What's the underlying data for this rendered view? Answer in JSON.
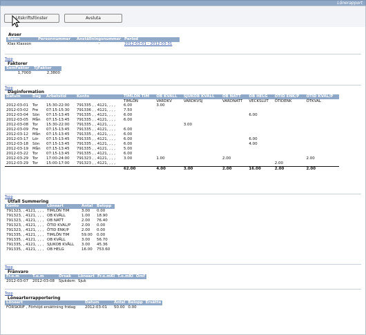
{
  "window": {
    "title": "Lönerapport"
  },
  "toolbar": {
    "print_label": "Utskriftsfönster",
    "close_label": "Avsluta"
  },
  "links": {
    "top": "Topp"
  },
  "avser": {
    "title": "Avser",
    "headers": [
      "Namn",
      "Personnummer",
      "Anställningsnummer",
      "Period"
    ],
    "row": [
      "Klas Klasson",
      "",
      "-",
      "2012-03-01 - 2012-03-31"
    ]
  },
  "faktorer": {
    "title": "Faktorer",
    "headers": [
      "SemFaktor",
      "TjFaktor"
    ],
    "row": [
      "1,7000",
      "2,3800"
    ]
  },
  "dag": {
    "title": "Daginformation",
    "headers": [
      "Datum",
      "Dag",
      "Arbetstid",
      "Konto",
      "TIMLÖN TIM",
      "OB KVÄLL",
      "SJUKOB KVÄLL",
      "OB NATT",
      "OB HELG",
      "ÖTID ENK/P",
      "ÖTID KVAL/P"
    ],
    "subheaders": [
      "",
      "",
      "",
      "",
      "TIMLÖN",
      "VARDKV",
      "VARDKVSJ",
      "VARDNATT",
      "VECKSLUT",
      "ÖTIDENK",
      "ÖTKVAL"
    ],
    "rows": [
      [
        "2012-03-01",
        "Tor",
        "15:30-22:00",
        "791335 , , 4121, , , ,",
        "6.00",
        "3.00",
        "",
        "",
        "",
        "",
        ""
      ],
      [
        "2012-03-02",
        "Fre",
        "07:15-15:30",
        "791336 , , 4121, , , ,",
        "7.50",
        "",
        "",
        "",
        "",
        "",
        ""
      ],
      [
        "2012-03-04",
        "Sön",
        "07:15-13:45",
        "791335 , , 4121, , , ,",
        "6.00",
        "",
        "",
        "",
        "6.00",
        "",
        ""
      ],
      [
        "2012-03-05",
        "Mån",
        "07:15-13:45",
        "791335 , , 4121, , , ,",
        "6.00",
        "",
        "",
        "",
        "",
        "",
        ""
      ],
      [
        "2012-03-08",
        "Tor",
        "15:30-22:00",
        "791335 , , 4121, , , ,",
        "",
        "",
        "3.00",
        "",
        "",
        "",
        ""
      ],
      [
        "2012-03-09",
        "Fre",
        "07:15-13:45",
        "791335 , , 4121, , , ,",
        "6.00",
        "",
        "",
        "",
        "",
        "",
        ""
      ],
      [
        "2012-03-12",
        "Mån",
        "07:15-13:45",
        "791335 , , 4121, , , ,",
        "6.00",
        "",
        "",
        "",
        "",
        "",
        ""
      ],
      [
        "2012-03-17",
        "Lör",
        "07:15-13:45",
        "791335 , , 4121, , , ,",
        "6.00",
        "",
        "",
        "",
        "6.00",
        "",
        ""
      ],
      [
        "2012-03-18",
        "Sön",
        "07:15-13:45",
        "791335 , , 4121, , , ,",
        "6.00",
        "",
        "",
        "",
        "4.00",
        "",
        ""
      ],
      [
        "2012-03-19",
        "Mån",
        "07:15-13:45",
        "791335 , , 4121, , , ,",
        "5.00",
        "",
        "",
        "",
        "",
        "",
        ""
      ],
      [
        "2012-03-22",
        "Tor",
        "07:15-13:45",
        "791335 , , 4121, , , ,",
        "6.00",
        "",
        "",
        "",
        "",
        "",
        ""
      ],
      [
        "2012-03-29",
        "Tor",
        "17:00-24:00",
        "791323 , , 4121, , , ,",
        "3.00",
        "1.00",
        "",
        "2.00",
        "",
        "",
        "2.00"
      ],
      [
        "2012-03-29",
        "Tor",
        "15:00-17:00",
        "791323 , , 4121, , , ,",
        "",
        "",
        "",
        "",
        "",
        "2.00",
        ""
      ]
    ],
    "totals": [
      "",
      "",
      "",
      "",
      "62.00",
      "4.00",
      "3.00",
      "2.00",
      "16.00",
      "2.00",
      "2.00"
    ]
  },
  "utfall": {
    "title": "Utfall Summering",
    "headers": [
      "Konto",
      "Löneart",
      "Antal",
      "Belopp"
    ],
    "rows": [
      [
        "791323, , 4121, , , ,",
        "TIMLÖN TIM",
        "3.00",
        "0.00"
      ],
      [
        "791323, , 4121, , , ,",
        "OB KVÄLL",
        "1.00",
        "18.90"
      ],
      [
        "791323, , 4121, , , ,",
        "OB NATT",
        "2.00",
        "76.40"
      ],
      [
        "791323, , 4121, , , ,",
        "ÖTID KVAL/P",
        "2.00",
        "0.00"
      ],
      [
        "791323, , 4121, , , ,",
        "ÖTID ENK/P",
        "2.00",
        "0.00"
      ],
      [
        "791335, , 4121, , , ,",
        "TIMLÖN TIM",
        "59.00",
        "0.00"
      ],
      [
        "791335, , 4121, , , ,",
        "OB KVÄLL",
        "3.00",
        "56.70"
      ],
      [
        "791335, , 4121, , , ,",
        "SJUKOB KVÄLL",
        "3.00",
        "45.36"
      ],
      [
        "791335, , 4121, , , ,",
        "OB HELG",
        "16.00",
        "753.60"
      ]
    ]
  },
  "franvaro": {
    "title": "Frånvaro",
    "headers": [
      "Fr.o.m",
      "T.o.m",
      "Orsak",
      "Löneart",
      "Fr.o.mKl",
      "T.o.mKl",
      "Omf"
    ],
    "row": [
      "2012-03-07",
      "2012-03-08",
      "Sjukdom",
      "Sjuk",
      "",
      "",
      ""
    ]
  },
  "lonearter": {
    "title": "Lönearterrapportering",
    "headers": [
      "Löneart",
      "Datum",
      "Antal",
      "Belopp",
      "Ersätte"
    ],
    "row": [
      "FÖRSKRIF , Förhöjd ersättning fridag",
      "2012-03-01",
      "50.00",
      "0.00",
      ""
    ]
  }
}
